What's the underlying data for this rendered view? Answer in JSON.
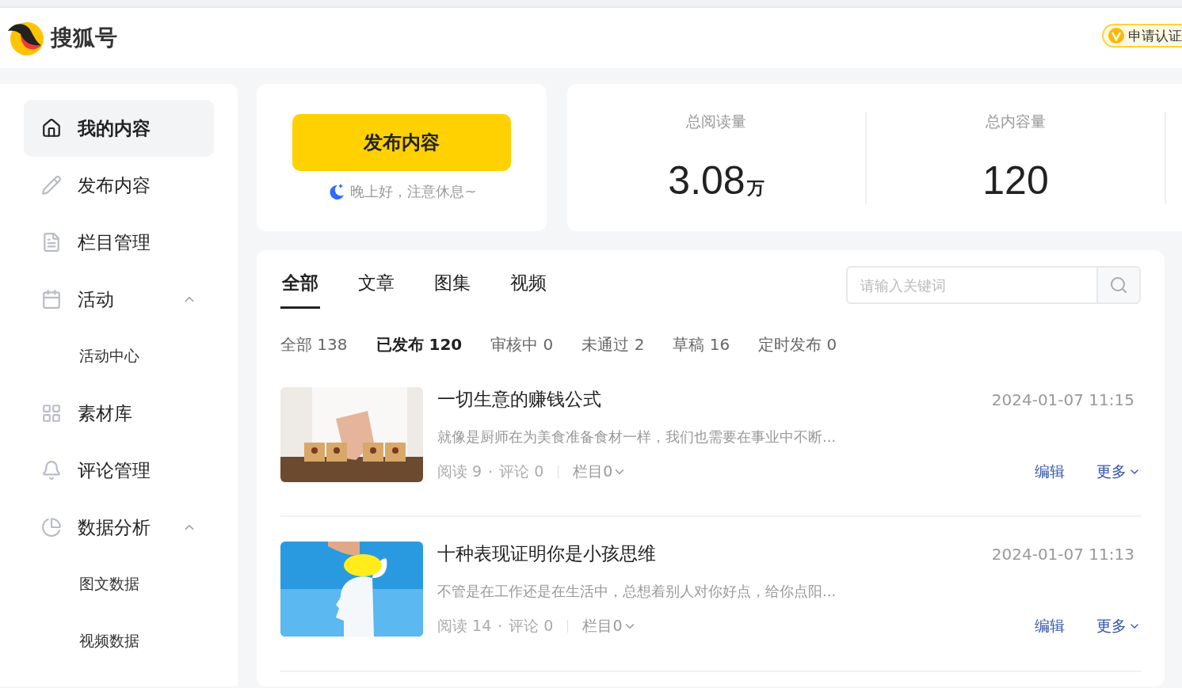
{
  "header": {
    "brand": "搜狐号",
    "certify_button": "申请认证"
  },
  "sidebar": {
    "items": [
      {
        "label": "我的内容",
        "selected": true
      },
      {
        "label": "发布内容",
        "selected": false
      },
      {
        "label": "栏目管理",
        "selected": false
      },
      {
        "label": "活动",
        "selected": false,
        "expanded": true,
        "children": [
          {
            "label": "活动中心",
            "selected": false
          }
        ]
      },
      {
        "label": "素材库",
        "selected": false
      },
      {
        "label": "评论管理",
        "selected": false
      },
      {
        "label": "数据分析",
        "selected": false,
        "expanded": true,
        "children": [
          {
            "label": "图文数据",
            "selected": false
          },
          {
            "label": "视频数据",
            "selected": false
          }
        ]
      }
    ]
  },
  "publish_card": {
    "button": "发布内容",
    "greeting": "晚上好，注意休息~"
  },
  "stats": [
    {
      "label": "总阅读量",
      "value": "3.08",
      "unit": "万"
    },
    {
      "label": "总内容量",
      "value": "120"
    }
  ],
  "content": {
    "tabs": [
      {
        "label": "全部",
        "selected": true
      },
      {
        "label": "文章",
        "selected": false
      },
      {
        "label": "图集",
        "selected": false
      },
      {
        "label": "视频",
        "selected": false
      }
    ],
    "search": {
      "placeholder": "请输入关键词"
    },
    "filters": [
      {
        "label": "全部 138",
        "selected": false
      },
      {
        "label": "已发布 120",
        "selected": true
      },
      {
        "label": "审核中 0",
        "selected": false
      },
      {
        "label": "未通过 2",
        "selected": false
      },
      {
        "label": "草稿 16",
        "selected": false
      },
      {
        "label": "定时发布 0",
        "selected": false
      }
    ],
    "articles": [
      {
        "title": "一切生意的赚钱公式",
        "date": "2024-01-07 11:15",
        "summary": "就像是厨师在为美食准备食材一样，我们也需要在事业中不断...",
        "reads": "阅读 9",
        "separator": "·",
        "comments": "评论 0",
        "column": "栏目0",
        "edit": "编辑",
        "more": "更多"
      },
      {
        "title": "十种表现证明你是小孩思维",
        "date": "2024-01-07 11:13",
        "summary": "不管是在工作还是在生活中，总想着别人对你好点，给你点阳...",
        "reads": "阅读 14",
        "separator": "·",
        "comments": "评论 0",
        "column": "栏目0",
        "edit": "编辑",
        "more": "更多"
      }
    ]
  }
}
